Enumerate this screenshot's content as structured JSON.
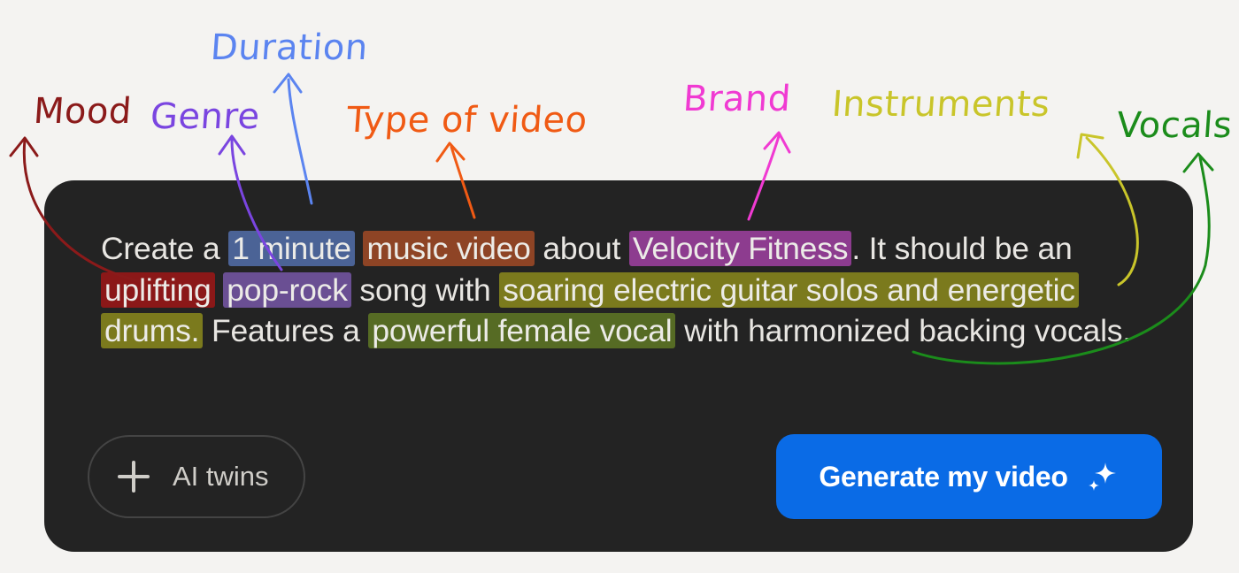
{
  "annotations": [
    {
      "key": "mood",
      "label": "Mood",
      "color": "#8b1a1a"
    },
    {
      "key": "genre",
      "label": "Genre",
      "color": "#7a45e0"
    },
    {
      "key": "duration",
      "label": "Duration",
      "color": "#5b84f0"
    },
    {
      "key": "type",
      "label": "Type of video",
      "color": "#f05a14"
    },
    {
      "key": "brand",
      "label": "Brand",
      "color": "#f03ad2"
    },
    {
      "key": "instruments",
      "label": "Instruments",
      "color": "#b8b520"
    },
    {
      "key": "vocals",
      "label": "Vocals",
      "color": "#1b8c1b"
    }
  ],
  "prompt": {
    "t1": "Create a ",
    "duration": "1 minute",
    "t2": " ",
    "type": "music video",
    "t3": " about ",
    "brand": "Velocity Fitness",
    "t4": ". It should be an ",
    "mood": "uplifting",
    "t5": " ",
    "genre": "pop-rock",
    "t6": " song with ",
    "instruments": "soaring electric guitar solos and energetic drums.",
    "t7": " Features a ",
    "vocals": "powerful female vocal",
    "t8": " with harmonized backing vocals."
  },
  "actions": {
    "ai_twins_label": "AI twins",
    "generate_label": "Generate my video",
    "plus_icon": "plus-icon",
    "sparkle_icon": "sparkle-icon"
  },
  "colors": {
    "card_background": "#232323",
    "page_background": "#f4f3f1",
    "generate_button": "#0a6be6"
  }
}
